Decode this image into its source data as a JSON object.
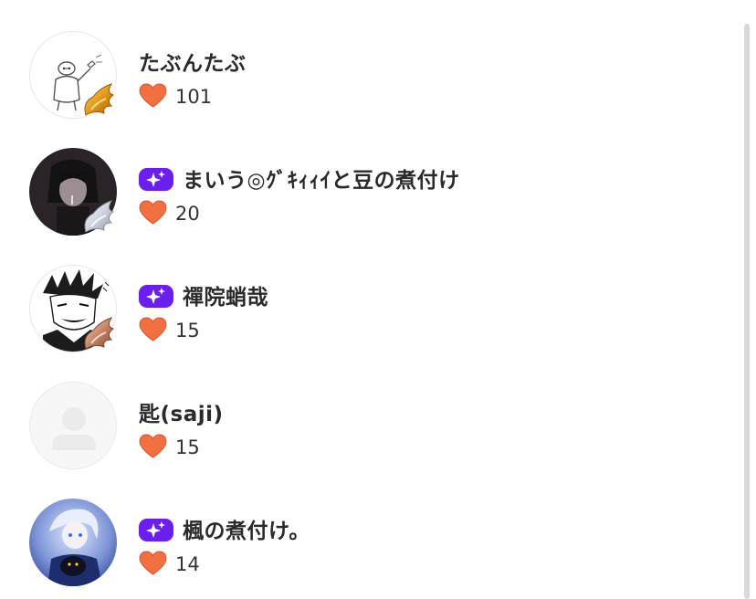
{
  "colors": {
    "premium_badge": "#6a1ff0",
    "heart": "#f26f3f",
    "name_text": "#2a2a2a",
    "count_text": "#333333",
    "scrollbar": "#d9d9d9"
  },
  "users": [
    {
      "name": "たぶんたぶ",
      "likes": "101",
      "premium": false,
      "avatar": "baymax-sketch",
      "frame": "gold-wing"
    },
    {
      "name": "まいう◎ｸﾞｷｨｨｲと豆の煮付け",
      "likes": "20",
      "premium": true,
      "avatar": "dark-portrait",
      "frame": "silver-wing"
    },
    {
      "name": "禪院蛸哉",
      "likes": "15",
      "premium": true,
      "avatar": "manga-sketch",
      "frame": "bronze-wing"
    },
    {
      "name": "匙(saji)",
      "likes": "15",
      "premium": false,
      "avatar": "default-person",
      "frame": "none"
    },
    {
      "name": "楓の煮付け。",
      "likes": "14",
      "premium": true,
      "avatar": "blue-anime",
      "frame": "none"
    }
  ]
}
